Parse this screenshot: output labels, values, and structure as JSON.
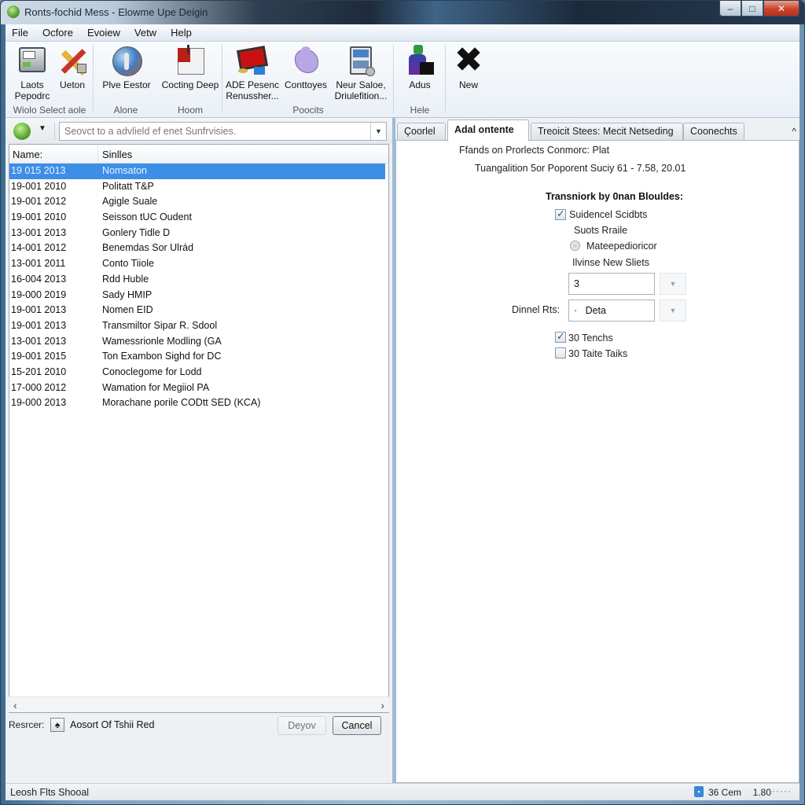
{
  "window": {
    "title": "Ronts-fochid Mess - Elowme Upe Deigin",
    "controls": {
      "minimize": "–",
      "maximize": "□",
      "close": "✕"
    }
  },
  "menu": [
    "File",
    "Ocfore",
    "Evoiew",
    "Vetw",
    "Help"
  ],
  "ribbon": {
    "groups": [
      {
        "label": "Wiolo Select aole",
        "buttons": [
          {
            "label": "Laots Pepodrc",
            "icon": "laptop-icon"
          },
          {
            "label": "Ueton",
            "icon": "tools-icon"
          }
        ]
      },
      {
        "label": "Alone",
        "buttons": [
          {
            "label": "Plve Eestor",
            "icon": "globe-icon"
          }
        ]
      },
      {
        "label": "Hoom",
        "buttons": [
          {
            "label": "Cocting Deep",
            "icon": "document-icon"
          }
        ]
      },
      {
        "label": "Poocits",
        "buttons": [
          {
            "label": "ADE Pesenc Renussher...",
            "icon": "monitor-icon"
          },
          {
            "label": "Conttoyes",
            "icon": "puzzle-icon"
          },
          {
            "label": "Neur Saloe, Driulefition...",
            "icon": "window-icon"
          }
        ]
      },
      {
        "label": "Hele",
        "buttons": [
          {
            "label": "Adus",
            "icon": "user-icon"
          }
        ]
      },
      {
        "label": "",
        "buttons": [
          {
            "label": "New",
            "icon": "x-icon"
          }
        ]
      }
    ]
  },
  "left": {
    "search_placeholder": "Seovct to a advlield ef enet Sunfrvisies.",
    "columns": [
      "Name:",
      "Sinlles"
    ],
    "rows": [
      {
        "date": "19 015 2013",
        "name": "Nomsaton",
        "selected": true
      },
      {
        "date": "19-001 2010",
        "name": "Politatt T&P"
      },
      {
        "date": "19-001 2012",
        "name": "Agigle Suale"
      },
      {
        "date": "19-001 2010",
        "name": "Seisson tUC Oudent"
      },
      {
        "date": "13-001 2013",
        "name": "Gonlery Tidle D"
      },
      {
        "date": "14-001 2012",
        "name": "Benemdas Sor Ulrád"
      },
      {
        "date": "13-001 2011",
        "name": "Conto Tiiole"
      },
      {
        "date": "16-004 2013",
        "name": "Rdd Huble"
      },
      {
        "date": "19-000 2019",
        "name": "Sady HMIP"
      },
      {
        "date": "19-001 2013",
        "name": "Nomen EID"
      },
      {
        "date": "19-001 2013",
        "name": "Transmiltor Sipar R. Sdool"
      },
      {
        "date": "13-001 2013",
        "name": "Wamessrionle Modling (GA"
      },
      {
        "date": "19-001 2015",
        "name": "Ton Exambon Sighd for DC"
      },
      {
        "date": "15-201 2010",
        "name": "Conoclegome for Lodd"
      },
      {
        "date": "17-000 2012",
        "name": "Wamation for Megiiol PA"
      },
      {
        "date": "19-000 2013",
        "name": "Morachane porile CODtt SED (KCA)"
      }
    ],
    "resource_label": "Resrcer:",
    "resource_value": "Aosort Of Tshii Red",
    "deploy_label": "Deyov",
    "cancel_label": "Cancel"
  },
  "right": {
    "tabs": [
      "Çoorlel",
      "Adal ontente",
      "Treoicit Stees:  Mecit Netseding",
      "Coonechts"
    ],
    "active_tab": 1,
    "line1": "Ffands on Prorlects Conmorc: Plat",
    "line2": "Tuangalition 5or Poporent Suciy 61 - 7.58, 20.01",
    "section_title": "Transniork by 0nan Blouldes:",
    "checkbox1": {
      "label": "Suidencel Scidbts",
      "checked": true
    },
    "label_sports": "Suots Rraile",
    "radio1": {
      "label": "Mateepedioricor",
      "selected": false
    },
    "label_new": "Ilvinse New Sliets",
    "field1_value": "3",
    "field2_label": "Dinnel Rts:",
    "field2_value": "·   Deta",
    "checkbox2": {
      "label": "30 Tenchs",
      "checked": true
    },
    "checkbox3": {
      "label": "30 Taite Taiks",
      "checked": false
    }
  },
  "status": {
    "left": "Leosh Flts Shooal",
    "zoom": "36 Cem",
    "count": "1.80",
    "dots": "·····"
  }
}
